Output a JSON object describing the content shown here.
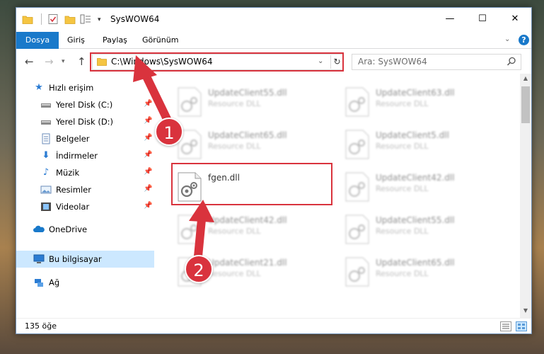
{
  "window": {
    "title": "SysWOW64",
    "controls": {
      "minimize": "—",
      "maximize": "☐",
      "close": "✕"
    }
  },
  "ribbon": {
    "tabs": [
      "Dosya",
      "Giriş",
      "Paylaş",
      "Görünüm"
    ]
  },
  "nav": {
    "address": "C:\\Windows\\SysWOW64",
    "search_placeholder": "Ara: SysWOW64"
  },
  "sidebar": {
    "items": [
      {
        "label": "Hızlı erişim",
        "icon": "star-icon"
      },
      {
        "label": "Yerel Disk (C:)",
        "icon": "drive-icon"
      },
      {
        "label": "Yerel Disk (D:)",
        "icon": "drive-icon"
      },
      {
        "label": "Belgeler",
        "icon": "documents-icon"
      },
      {
        "label": "İndirmeler",
        "icon": "download-icon"
      },
      {
        "label": "Müzik",
        "icon": "music-icon"
      },
      {
        "label": "Resimler",
        "icon": "pictures-icon"
      },
      {
        "label": "Videolar",
        "icon": "videos-icon"
      },
      {
        "label": "OneDrive",
        "icon": "cloud-icon"
      },
      {
        "label": "Bu bilgisayar",
        "icon": "computer-icon"
      },
      {
        "label": "Ağ",
        "icon": "network-icon"
      }
    ]
  },
  "files": {
    "left": [
      {
        "name": "UpdateClient55.dll",
        "type": "Resource DLL"
      },
      {
        "name": "UpdateClient65.dll",
        "type": "Resource DLL"
      },
      {
        "name": "fgen.dll",
        "type": ""
      },
      {
        "name": "UpdateClient42.dll",
        "type": "Resource DLL"
      },
      {
        "name": "UpdateClient21.dll",
        "type": "Resource DLL"
      }
    ],
    "right": [
      {
        "name": "UpdateClient63.dll",
        "type": "Resource DLL"
      },
      {
        "name": "UpdateClient5.dll",
        "type": "Resource DLL"
      },
      {
        "name": "UpdateClient42.dll",
        "type": "Resource DLL"
      },
      {
        "name": "UpdateClient55.dll",
        "type": "Resource DLL"
      },
      {
        "name": "UpdateClient65.dll",
        "type": "Resource DLL"
      }
    ]
  },
  "status": {
    "count": "135 öğe"
  },
  "annotations": {
    "badge1": "1",
    "badge2": "2"
  },
  "colors": {
    "accent": "#1979ca",
    "highlight": "#d9333d",
    "selection": "#cce8ff"
  }
}
